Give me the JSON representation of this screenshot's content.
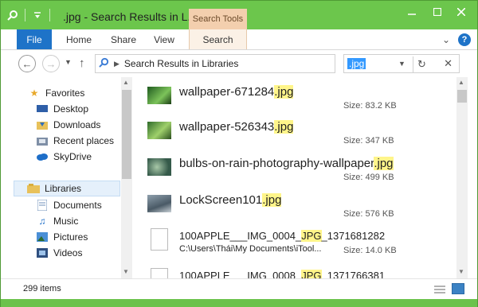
{
  "window": {
    "title": ".jpg - Search Results in L...",
    "context_tab_group": "Search Tools"
  },
  "ribbon": {
    "tabs": [
      "File",
      "Home",
      "Share",
      "View",
      "Search"
    ],
    "help_label": "?"
  },
  "address": {
    "path": "Search Results in Libraries"
  },
  "search": {
    "value": ".jpg"
  },
  "nav": {
    "favorites_label": "Favorites",
    "items": [
      {
        "label": "Desktop"
      },
      {
        "label": "Downloads"
      },
      {
        "label": "Recent places"
      },
      {
        "label": "SkyDrive"
      }
    ],
    "libraries_label": "Libraries",
    "library_items": [
      {
        "label": "Documents"
      },
      {
        "label": "Music"
      },
      {
        "label": "Pictures"
      },
      {
        "label": "Videos"
      }
    ]
  },
  "results": [
    {
      "name_prefix": "wallpaper-671284",
      "name_ext": ".jpg",
      "size": "Size: 83.2 KB"
    },
    {
      "name_prefix": "wallpaper-526343",
      "name_ext": ".jpg",
      "size": "Size: 347 KB"
    },
    {
      "name_prefix": "bulbs-on-rain-photography-wallpaper",
      "name_ext": ".jpg",
      "size": "Size: 499 KB"
    },
    {
      "name_prefix": "LockScreen101",
      "name_ext": ".jpg",
      "size": "Size: 576 KB"
    },
    {
      "name_prefix": "100APPLE___IMG_0004_",
      "name_ext": "JPG",
      "name_suffix": "_1371681282",
      "path": "C:\\Users\\Thái\\My Documents\\iTool...",
      "size": "Size: 14.0 KB"
    },
    {
      "name_prefix": "100APPLE___IMG_0008_",
      "name_ext": "JPG",
      "name_suffix": "_1371766381"
    }
  ],
  "status": {
    "item_count": "299 items"
  },
  "colors": {
    "accent": "#6bc24b",
    "file_tab": "#1e73c8",
    "highlight": "#fff58a",
    "search_tools_tab": "#f3cfae"
  }
}
